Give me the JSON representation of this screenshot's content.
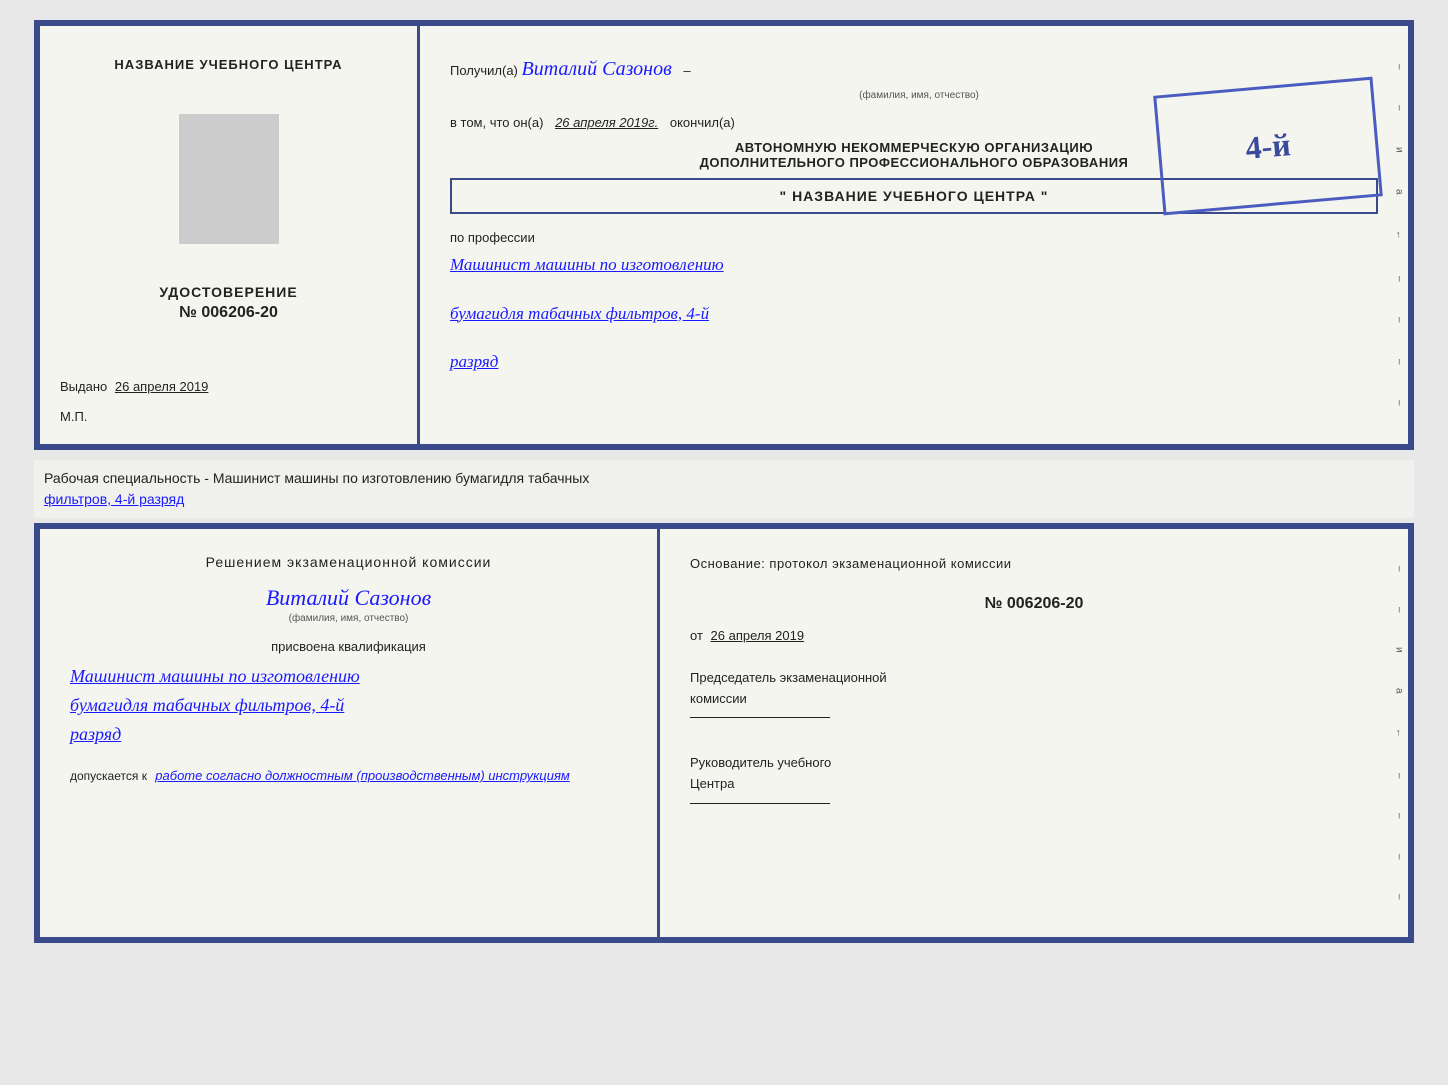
{
  "cert_top": {
    "left": {
      "title": "НАЗВАНИЕ УЧЕБНОГО ЦЕНТРА",
      "udost_label": "УДОСТОВЕРЕНИЕ",
      "udost_number": "№ 006206-20",
      "vydano_label": "Выдано",
      "vydano_date": "26 апреля 2019",
      "mp_label": "М.П."
    },
    "right": {
      "poluchil_prefix": "Получил(а)",
      "name": "Виталий Сазонов",
      "name_sub": "(фамилия, имя, отчество)",
      "dash": "–",
      "vtom_prefix": "в том, что он(а)",
      "vtom_date": "26 апреля 2019г.",
      "okonchil": "окончил(а)",
      "stamp_number": "4-й",
      "avt_line1": "АВТОНОМНУЮ НЕКОММЕРЧЕСКУЮ ОРГАНИЗАЦИЮ",
      "avt_line2": "ДОПОЛНИТЕЛЬНОГО ПРОФЕССИОНАЛЬНОГО ОБРАЗОВАНИЯ",
      "avt_name": "\" НАЗВАНИЕ УЧЕБНОГО ЦЕНТРА \"",
      "i_label": "и",
      "a_label": "а",
      "arrow": "←",
      "professiya_label": "по профессии",
      "professiya_name": "Машинист машины по изготовлению",
      "professiya_name2": "бумагидля табачных фильтров, 4-й",
      "professiya_razryad": "разряд"
    }
  },
  "separator": {
    "text_prefix": "Рабочая специальность - Машинист машины по изготовлению бумагидля табачных",
    "text_underline": "фильтров, 4-й разряд"
  },
  "cert_bot": {
    "left": {
      "title": "Решением  экзаменационной  комиссии",
      "name": "Виталий Сазонов",
      "name_sub": "(фамилия, имя, отчество)",
      "prisvoena": "присвоена квалификация",
      "kvalif1": "Машинист  машины  по  изготовлению",
      "kvalif2": "бумагидля  табачных  фильтров,  4-й",
      "kvalif3": "разряд",
      "dopusk_prefix": "допускается к",
      "dopusk_val": "работе согласно должностным (производственным) инструкциям"
    },
    "right": {
      "osnov": "Основание:  протокол  экзаменационной  комиссии",
      "number": "№  006206-20",
      "ot_prefix": "от",
      "ot_date": "26 апреля 2019",
      "predsed_line1": "Председатель экзаменационной",
      "predsed_line2": "комиссии",
      "ruk_line1": "Руководитель учебного",
      "ruk_line2": "Центра",
      "i_label": "и",
      "a_label": "а",
      "arrow": "←"
    }
  }
}
